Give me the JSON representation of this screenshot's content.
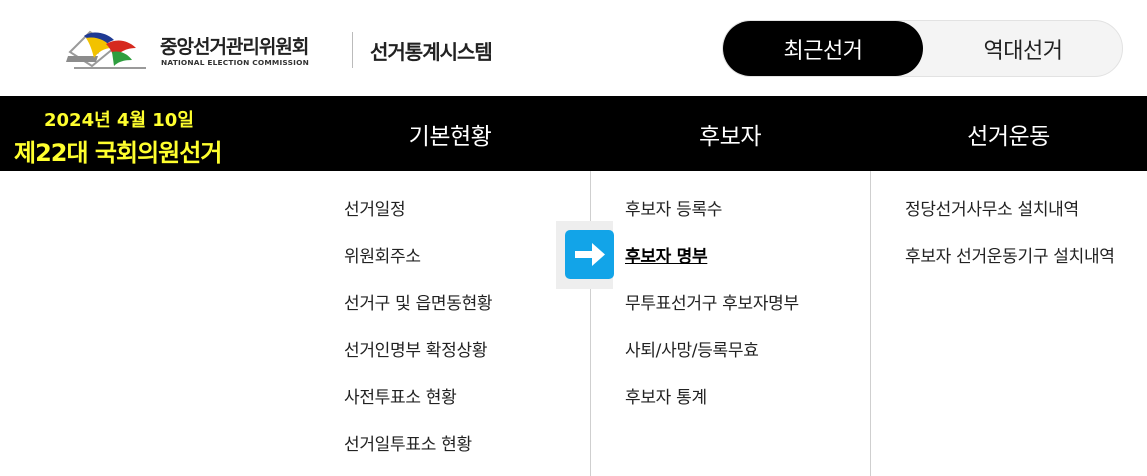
{
  "header": {
    "logo_ko": "중앙선거관리위원회",
    "logo_en": "NATIONAL ELECTION COMMISSION",
    "system_title": "선거통계시스템",
    "toggle": {
      "recent_label": "최근선거",
      "past_label": "역대선거",
      "active": "recent"
    }
  },
  "election": {
    "date": "2024년 4월 10일",
    "name": "제22대 국회의원선거"
  },
  "nav": {
    "tabs": [
      {
        "label": "기본현황"
      },
      {
        "label": "후보자"
      },
      {
        "label": "선거운동"
      }
    ]
  },
  "dropdown": {
    "columns": [
      {
        "items": [
          {
            "label": "선거일정"
          },
          {
            "label": "위원회주소"
          },
          {
            "label": "선거구 및 읍면동현황"
          },
          {
            "label": "선거인명부 확정상황"
          },
          {
            "label": "사전투표소 현황"
          },
          {
            "label": "선거일투표소 현황"
          }
        ]
      },
      {
        "items": [
          {
            "label": "후보자 등록수"
          },
          {
            "label": "후보자 명부",
            "active": true
          },
          {
            "label": "무투표선거구 후보자명부"
          },
          {
            "label": "사퇴/사망/등록무효"
          },
          {
            "label": "후보자 통계"
          }
        ]
      },
      {
        "items": [
          {
            "label": "정당선거사무소 설치내역"
          },
          {
            "label": "후보자 선거운동기구 설치내역"
          }
        ]
      }
    ]
  },
  "colors": {
    "nav_bg": "#000000",
    "election_text": "#ffff2e",
    "arrow_bg": "#12a4e8",
    "toggle_active_bg": "#000000"
  },
  "icons": {
    "logo": "nec-emblem-icon",
    "arrow": "arrow-right-icon"
  }
}
